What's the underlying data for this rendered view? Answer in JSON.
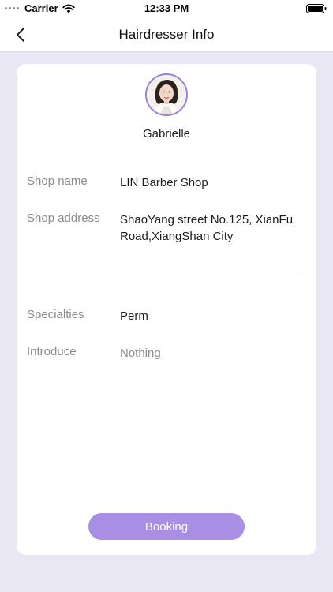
{
  "status_bar": {
    "carrier": "Carrier",
    "time": "12:33 PM",
    "icons": [
      "signal-dots-icon",
      "wifi-icon",
      "battery-icon"
    ]
  },
  "nav": {
    "title": "Hairdresser Info",
    "back_icon": "chevron-left-icon"
  },
  "profile": {
    "name": "Gabrielle",
    "avatar": "avatar-photo"
  },
  "details": {
    "shop_name_label": "Shop name",
    "shop_name_value": "LIN Barber Shop",
    "shop_address_label": "Shop address",
    "shop_address_value": "ShaoYang street No.125, XianFu Road,XiangShan City",
    "specialties_label": "Specialties",
    "specialties_value": "Perm",
    "introduce_label": "Introduce",
    "introduce_value": "Nothing"
  },
  "actions": {
    "booking_label": "Booking"
  },
  "colors": {
    "background": "#e9e7f3",
    "accent": "#a98ee6",
    "avatar_border": "#9b7fe0",
    "label_gray": "#8b8b8b"
  }
}
